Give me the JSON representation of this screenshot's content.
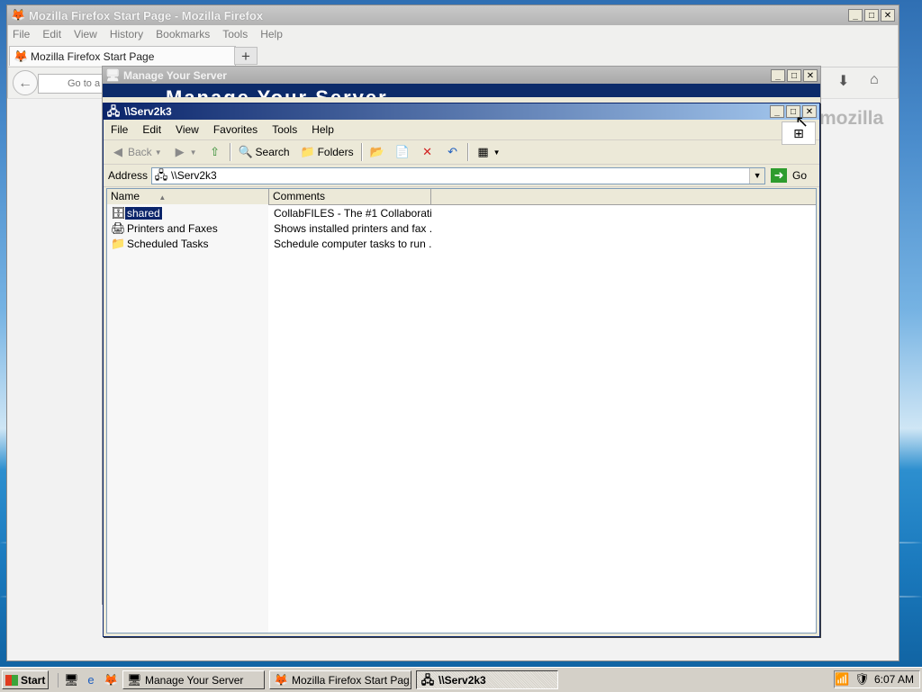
{
  "firefox": {
    "title": "Mozilla Firefox Start Page - Mozilla Firefox",
    "menu": [
      "File",
      "Edit",
      "View",
      "History",
      "Bookmarks",
      "Tools",
      "Help"
    ],
    "tab_label": "Mozilla Firefox Start Page",
    "url_placeholder": "Go to a W",
    "brand_text": "mozilla"
  },
  "manage_server": {
    "title": "Manage Your Server",
    "banner": "Manage Your Server"
  },
  "explorer": {
    "title": "\\\\Serv2k3",
    "menu": [
      "File",
      "Edit",
      "View",
      "Favorites",
      "Tools",
      "Help"
    ],
    "toolbar": {
      "back": "Back",
      "search": "Search",
      "folders": "Folders"
    },
    "address_label": "Address",
    "address_value": "\\\\Serv2k3",
    "go_label": "Go",
    "columns": [
      "Name",
      "Comments"
    ],
    "rows": [
      {
        "name": "shared",
        "comment": "CollabFILES - The #1 Collaborati...",
        "icon": "network-share-icon"
      },
      {
        "name": "Printers and Faxes",
        "comment": "Shows installed printers and fax ...",
        "icon": "printer-icon"
      },
      {
        "name": "Scheduled Tasks",
        "comment": "Schedule computer tasks to run ...",
        "icon": "scheduled-tasks-folder-icon"
      }
    ]
  },
  "taskbar": {
    "start": "Start",
    "tasks": [
      "Manage Your Server",
      "Mozilla Firefox Start Pag...",
      "\\\\Serv2k3"
    ],
    "clock": "6:07 AM"
  }
}
